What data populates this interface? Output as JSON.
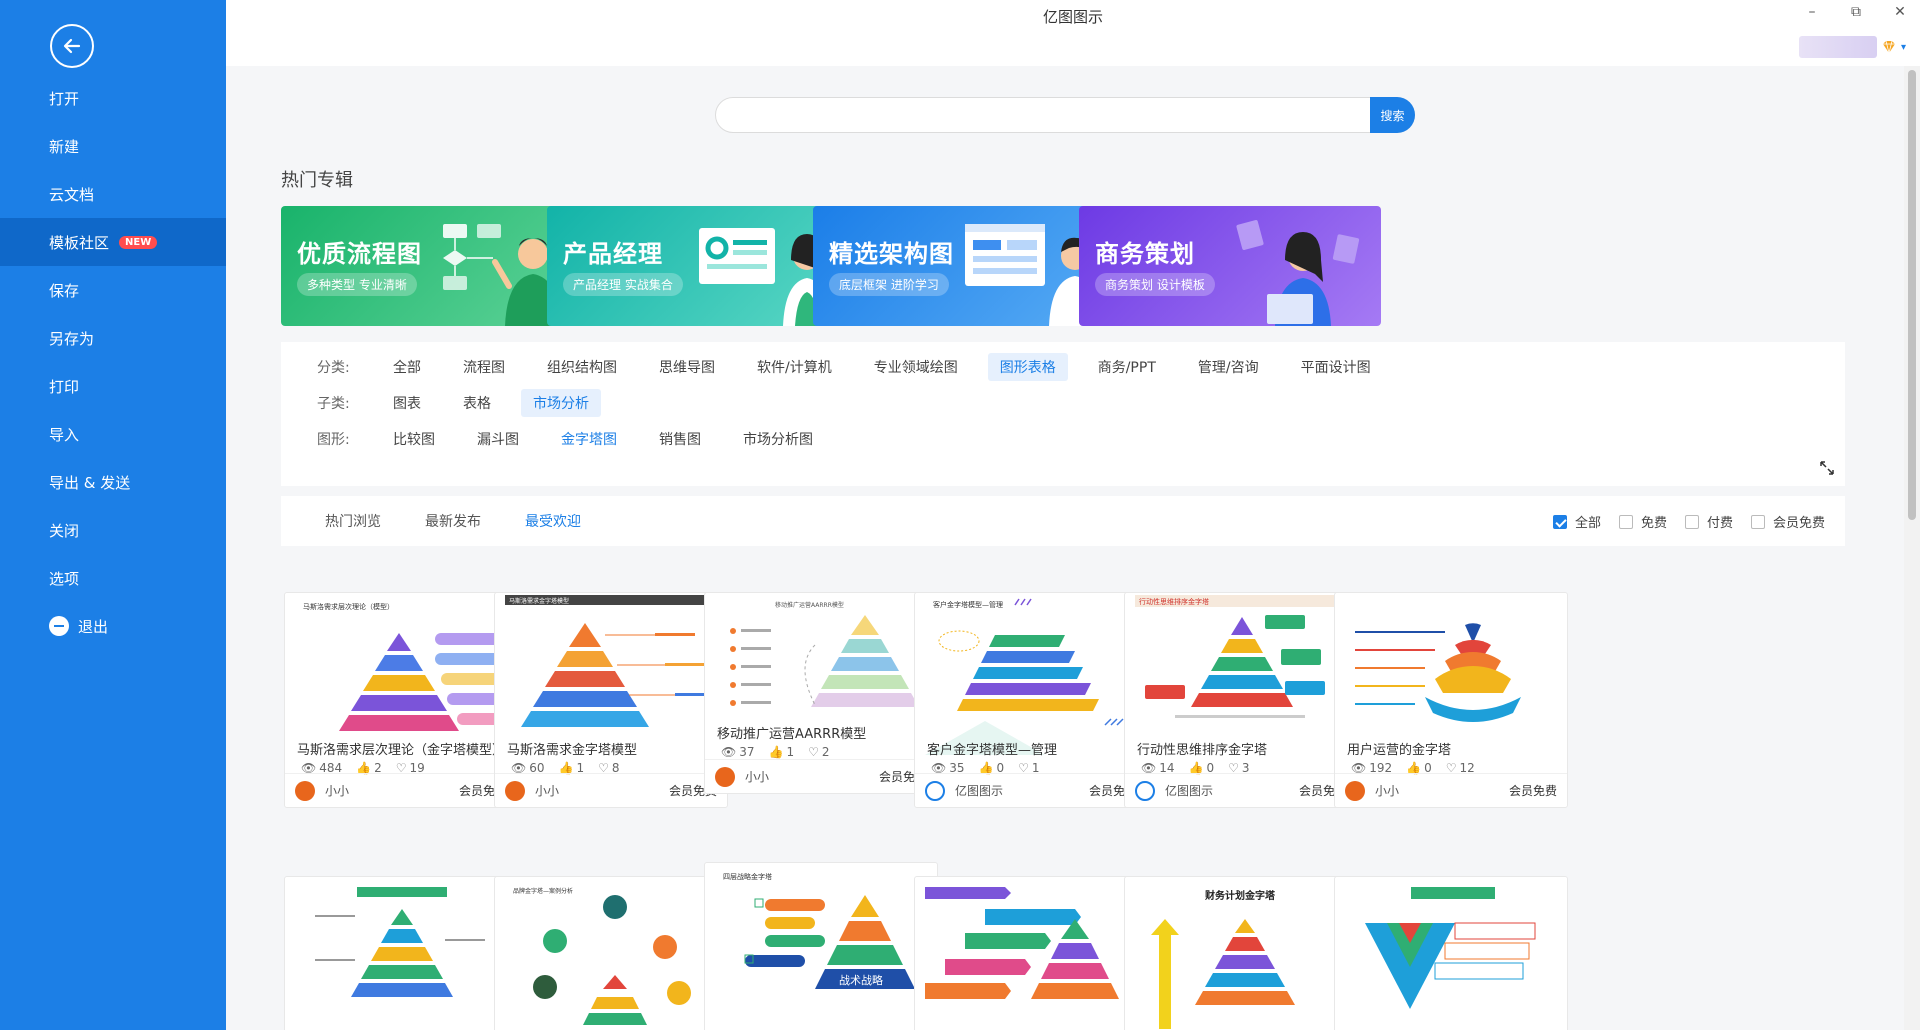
{
  "sidebar": {
    "items": [
      {
        "label": "打开"
      },
      {
        "label": "新建"
      },
      {
        "label": "云文档"
      },
      {
        "label": "模板社区",
        "badge": "NEW",
        "active": true
      },
      {
        "label": "保存"
      },
      {
        "label": "另存为"
      },
      {
        "label": "打印"
      },
      {
        "label": "导入"
      },
      {
        "label": "导出 & 发送"
      },
      {
        "label": "关闭"
      },
      {
        "label": "选项"
      },
      {
        "label": "退出"
      }
    ]
  },
  "window": {
    "title": "亿图图示",
    "controls": [
      "–",
      "⧉",
      "✕"
    ]
  },
  "search": {
    "value": "",
    "placeholder": "",
    "button_label": "搜索"
  },
  "hot": {
    "title": "热门专辑",
    "banners": [
      {
        "title": "优质流程图",
        "subtitle": "多种类型 专业清晰",
        "color_start": "#19b36b",
        "color_end": "#6fd6a0"
      },
      {
        "title": "产品经理",
        "subtitle": "产品经理 实战集合",
        "color_start": "#12b3a8",
        "color_end": "#62dcc8"
      },
      {
        "title": "精选架构图",
        "subtitle": "底层框架 进阶学习",
        "color_start": "#1b7ee8",
        "color_end": "#64b3f7"
      },
      {
        "title": "商务策划",
        "subtitle": "商务策划 设计模板",
        "color_start": "#7440e6",
        "color_end": "#a87af2"
      }
    ]
  },
  "filters": {
    "category": {
      "label": "分类:",
      "options": [
        "全部",
        "流程图",
        "组织结构图",
        "思维导图",
        "软件/计算机",
        "专业领域绘图",
        "图形表格",
        "商务/PPT",
        "管理/咨询",
        "平面设计图"
      ],
      "active": "图形表格"
    },
    "subcategory": {
      "label": "子类:",
      "options": [
        "图表",
        "表格",
        "市场分析"
      ],
      "active": "市场分析"
    },
    "shape": {
      "label": "图形:",
      "options": [
        "比较图",
        "漏斗图",
        "金字塔图",
        "销售图",
        "市场分析图"
      ],
      "active": "金字塔图"
    }
  },
  "sort": {
    "tabs": [
      "热门浏览",
      "最新发布",
      "最受欢迎"
    ],
    "active": "最受欢迎",
    "price_filters": [
      {
        "label": "全部",
        "checked": true
      },
      {
        "label": "免费",
        "checked": false
      },
      {
        "label": "付费",
        "checked": false
      },
      {
        "label": "会员免费",
        "checked": false
      }
    ]
  },
  "cards": [
    {
      "title": "马斯洛需求层次理论（金字塔模型）",
      "views": "484",
      "likes": "2",
      "favs": "19",
      "author": "小小",
      "price": "会员免费",
      "avatar_color": "#e8661c"
    },
    {
      "title": "马斯洛需求金字塔模型",
      "views": "60",
      "likes": "1",
      "favs": "8",
      "author": "小小",
      "price": "会员免费",
      "avatar_color": "#e8661c"
    },
    {
      "title": "移动推广运营AARRR模型",
      "views": "37",
      "likes": "1",
      "favs": "2",
      "author": "小小",
      "price": "会员免费",
      "avatar_color": "#e8661c"
    },
    {
      "title": "客户金字塔模型—管理",
      "views": "35",
      "likes": "0",
      "favs": "1",
      "author": "亿图图示",
      "price": "会员免费",
      "avatar_color": "#1c7fe6"
    },
    {
      "title": "行动性思维排序金字塔",
      "views": "14",
      "likes": "0",
      "favs": "3",
      "author": "亿图图示",
      "price": "会员免费",
      "avatar_color": "#1c7fe6"
    },
    {
      "title": "用户运营的金字塔",
      "views": "192",
      "likes": "0",
      "favs": "12",
      "author": "小小",
      "price": "会员免费",
      "avatar_color": "#e8661c"
    }
  ],
  "thumb_texts": {
    "row1": [
      "马斯洛需求层次理论（模型）",
      "马斯洛需求金字塔模型",
      "移动推广运营AARRR模型",
      "客户金字塔模型—管理",
      "行动性思维排序金字塔",
      ""
    ],
    "row2": [
      "",
      "品牌金字塔—案例分析",
      "四层战略金字塔",
      "",
      "财务计划金字塔",
      ""
    ],
    "row2_extra": {
      "card3_caption": "战术战略"
    }
  }
}
